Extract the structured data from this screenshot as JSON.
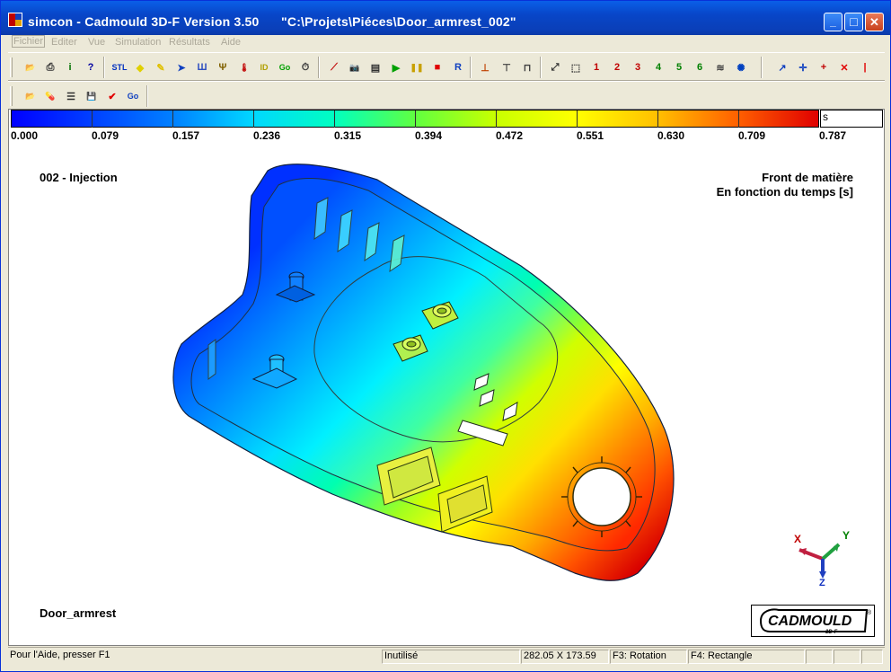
{
  "window": {
    "title": "simcon - Cadmould 3D-F Version 3.50      \"C:\\Projets\\Piéces\\Door_armrest_002\"",
    "minimize_label": "_",
    "maximize_label": "□",
    "close_label": "✕"
  },
  "menu": [
    "Fichier",
    "Editer",
    "Vue",
    "Simulation",
    "Résultats",
    "Aide"
  ],
  "toolbar1_icons": [
    {
      "name": "open-folder-icon",
      "glyph": "📂",
      "color": "#c8a000"
    },
    {
      "name": "print-icon",
      "glyph": "⎙",
      "color": "#303030"
    },
    {
      "name": "info-icon",
      "glyph": "i",
      "color": "#007000"
    },
    {
      "name": "help-icon",
      "glyph": "?",
      "color": "#0000a0"
    },
    {
      "name": "stl-icon",
      "glyph": "STL",
      "color": "#0030c0"
    },
    {
      "name": "label-icon",
      "glyph": "◆",
      "color": "#e0d000"
    },
    {
      "name": "pen-icon",
      "glyph": "✎",
      "color": "#e0c000"
    },
    {
      "name": "injection-icon",
      "glyph": "➤",
      "color": "#1040c0"
    },
    {
      "name": "cooling-icon",
      "glyph": "Ш",
      "color": "#3050c0"
    },
    {
      "name": "gate-icon",
      "glyph": "Ψ",
      "color": "#806000"
    },
    {
      "name": "thermometer-icon",
      "glyph": "🌡",
      "color": "#c00000"
    },
    {
      "name": "id-icon",
      "glyph": "ID",
      "color": "#b0a000"
    },
    {
      "name": "go-green-icon",
      "glyph": "Go",
      "color": "#00a000"
    },
    {
      "name": "timer-icon",
      "glyph": "⏱",
      "color": "#404040"
    },
    {
      "name": "chart-icon",
      "glyph": "⟋",
      "color": "#c00000"
    },
    {
      "name": "camera-icon",
      "glyph": "📷",
      "color": "#404040"
    },
    {
      "name": "film-icon",
      "glyph": "▤",
      "color": "#303030"
    },
    {
      "name": "play-icon",
      "glyph": "▶",
      "color": "#00a000"
    },
    {
      "name": "pause-icon",
      "glyph": "❚❚",
      "color": "#c8a000"
    },
    {
      "name": "stop-icon",
      "glyph": "■",
      "color": "#e00000"
    },
    {
      "name": "record-icon",
      "glyph": "R",
      "color": "#1040c0"
    },
    {
      "name": "section-1-icon",
      "glyph": "⊥",
      "color": "#c04000"
    },
    {
      "name": "section-2-icon",
      "glyph": "⊤",
      "color": "#404040"
    },
    {
      "name": "section-3-icon",
      "glyph": "⊓",
      "color": "#404040"
    },
    {
      "name": "fit-view-icon",
      "glyph": "⤢",
      "color": "#303030"
    },
    {
      "name": "zoom-rect-icon",
      "glyph": "⬚",
      "color": "#303030"
    },
    {
      "name": "view-1-icon",
      "glyph": "1",
      "color": "#c00000"
    },
    {
      "name": "view-2-icon",
      "glyph": "2",
      "color": "#c00000"
    },
    {
      "name": "view-3-icon",
      "glyph": "3",
      "color": "#c00000"
    },
    {
      "name": "view-4-icon",
      "glyph": "4",
      "color": "#008000"
    },
    {
      "name": "view-5-icon",
      "glyph": "5",
      "color": "#008000"
    },
    {
      "name": "view-6-icon",
      "glyph": "6",
      "color": "#008000"
    },
    {
      "name": "layers-icon",
      "glyph": "≋",
      "color": "#404040"
    },
    {
      "name": "light-icon",
      "glyph": "✺",
      "color": "#0040c0"
    },
    {
      "name": "arrow-icon",
      "glyph": "↗",
      "color": "#1040c0"
    },
    {
      "name": "axis-move-icon",
      "glyph": "✛",
      "color": "#1040c0"
    },
    {
      "name": "cross-red-icon",
      "glyph": "+",
      "color": "#c00000"
    },
    {
      "name": "delete-icon",
      "glyph": "✕",
      "color": "#e00000"
    },
    {
      "name": "line-red-icon",
      "glyph": "|",
      "color": "#e00000"
    }
  ],
  "toolbar2_icons": [
    {
      "name": "open-project-icon",
      "glyph": "📂",
      "color": "#c8a000"
    },
    {
      "name": "tube-icon",
      "glyph": "💊",
      "color": "#c00000"
    },
    {
      "name": "list-icon",
      "glyph": "☰",
      "color": "#303030"
    },
    {
      "name": "save-icon",
      "glyph": "💾",
      "color": "#202020"
    },
    {
      "name": "check-icon",
      "glyph": "✔",
      "color": "#e00000"
    },
    {
      "name": "go-blue-icon",
      "glyph": "Go",
      "color": "#1040c0"
    }
  ],
  "colorbar": {
    "unit": "s",
    "ticks": [
      "0.000",
      "0.079",
      "0.157",
      "0.236",
      "0.315",
      "0.394",
      "0.472",
      "0.551",
      "0.630",
      "0.709",
      "0.787"
    ]
  },
  "viewport": {
    "label_top_left": "002 - Injection",
    "result_title": "Front de matière",
    "result_subtitle": "En fonction du temps [s]",
    "model_name": "Door_armrest",
    "axis_x": "X",
    "axis_y": "Y",
    "axis_z": "Z",
    "logo_text": "CADMOULD",
    "logo_sub": "3D-F",
    "logo_reg": "®"
  },
  "statusbar": {
    "help": "Pour l'Aide, presser F1",
    "state": "Inutilisé",
    "dimensions": "282.05 X 173.59",
    "f3": "F3: Rotation",
    "f4": "F4: Rectangle"
  }
}
